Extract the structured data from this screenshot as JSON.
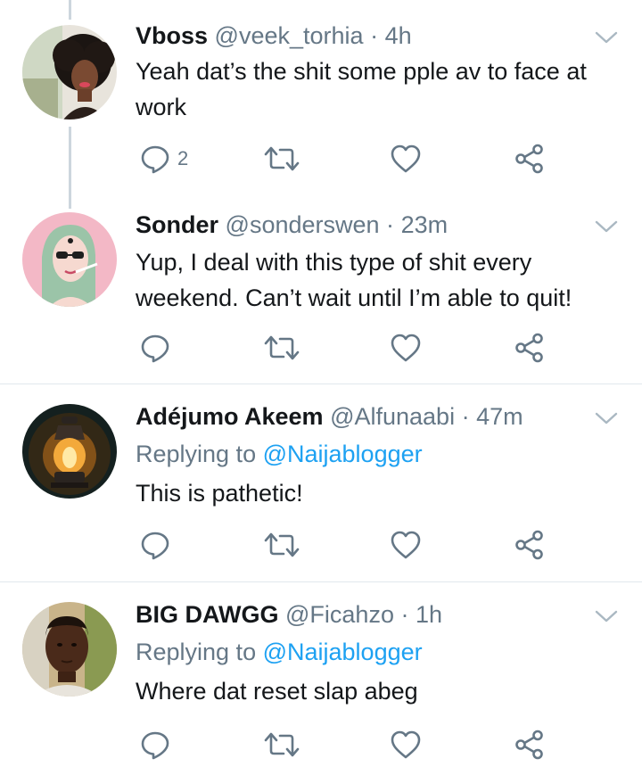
{
  "tweets": [
    {
      "name": "Vboss",
      "handle": "@veek_torhia",
      "time": "4h",
      "text": "Yeah dat’s the shit some pple av to face at work",
      "reply_count": "2"
    },
    {
      "name": "Sonder",
      "handle": "@sonderswen",
      "time": "23m",
      "text": "Yup, I deal with this type of shit every weekend. Can’t wait until I’m able to quit!"
    },
    {
      "name": "Adéjumo Akeem",
      "handle": "@Alfunaabi",
      "time": "47m",
      "replying_prefix": "Replying to",
      "replying_to": "@Naijablogger",
      "text": "This is pathetic!"
    },
    {
      "name": "BIG DAWGG",
      "handle": "@Ficahzo",
      "time": "1h",
      "replying_prefix": "Replying to",
      "replying_to": "@Naijablogger",
      "text": "Where dat reset slap abeg"
    }
  ],
  "separator": "·",
  "icons": {
    "reply": "reply-icon",
    "retweet": "retweet-icon",
    "like": "heart-icon",
    "share": "share-icon",
    "menu": "chevron-down-icon"
  },
  "colors": {
    "text": "#14171a",
    "secondary": "#657786",
    "link": "#1da1f2",
    "divider": "#e1e8ed",
    "thread_line": "#ccd6dd"
  }
}
